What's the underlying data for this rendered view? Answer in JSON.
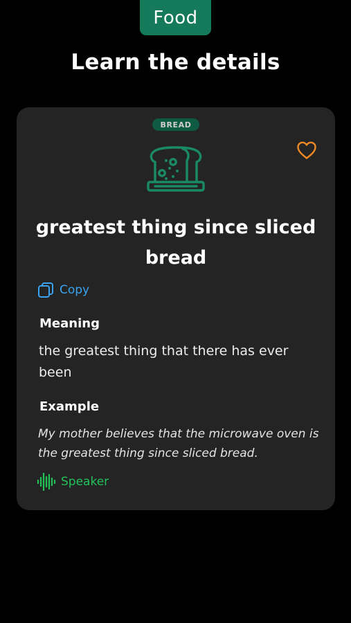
{
  "header": {
    "category_tab": "Food",
    "page_title": "Learn the details"
  },
  "card": {
    "tag": "BREAD",
    "phrase": "greatest thing since sliced bread",
    "copy_label": "Copy",
    "meaning_label": "Meaning",
    "meaning": "the greatest thing that there has ever been",
    "example_label": "Example",
    "example": "My mother believes that the microwave oven is the greatest thing since sliced bread.",
    "speaker_label": "Speaker"
  },
  "icons": {
    "favorite": "heart-outline-icon",
    "illustration": "bread-toast-icon",
    "copy": "copy-icon",
    "speaker": "sound-wave-icon"
  },
  "colors": {
    "background": "#000000",
    "card": "#242424",
    "accent_green": "#157a5a",
    "heart_orange": "#f08a24",
    "copy_blue": "#3aa3f0",
    "speaker_green": "#21c25a"
  }
}
